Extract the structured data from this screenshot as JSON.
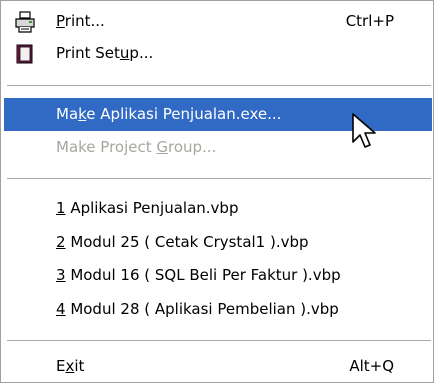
{
  "menu": {
    "items": [
      {
        "label": "Print...",
        "accel": "P",
        "shortcut": "Ctrl+P",
        "icon": "printer-icon"
      },
      {
        "label": "Print Setup...",
        "accel": "u",
        "shortcut": "",
        "icon": "print-setup-icon"
      },
      {
        "label": "Make Aplikasi Penjualan.exe...",
        "accel": "k",
        "shortcut": "",
        "state": "highlighted"
      },
      {
        "label": "Make Project Group...",
        "accel": "G",
        "shortcut": "",
        "state": "disabled"
      },
      {
        "label": "1 Aplikasi Penjualan.vbp",
        "accel": "1",
        "shortcut": ""
      },
      {
        "label": "2 Modul 25 ( Cetak Crystal1 ).vbp",
        "accel": "2",
        "shortcut": ""
      },
      {
        "label": "3 Modul 16 ( SQL Beli Per Faktur ).vbp",
        "accel": "3",
        "shortcut": ""
      },
      {
        "label": "4 Modul 28 ( Aplikasi Pembelian ).vbp",
        "accel": "4",
        "shortcut": ""
      },
      {
        "label": "Exit",
        "accel": "x",
        "shortcut": "Alt+Q"
      }
    ]
  },
  "colors": {
    "highlight": "#316ac5",
    "disabled_text": "#a7a69f"
  }
}
